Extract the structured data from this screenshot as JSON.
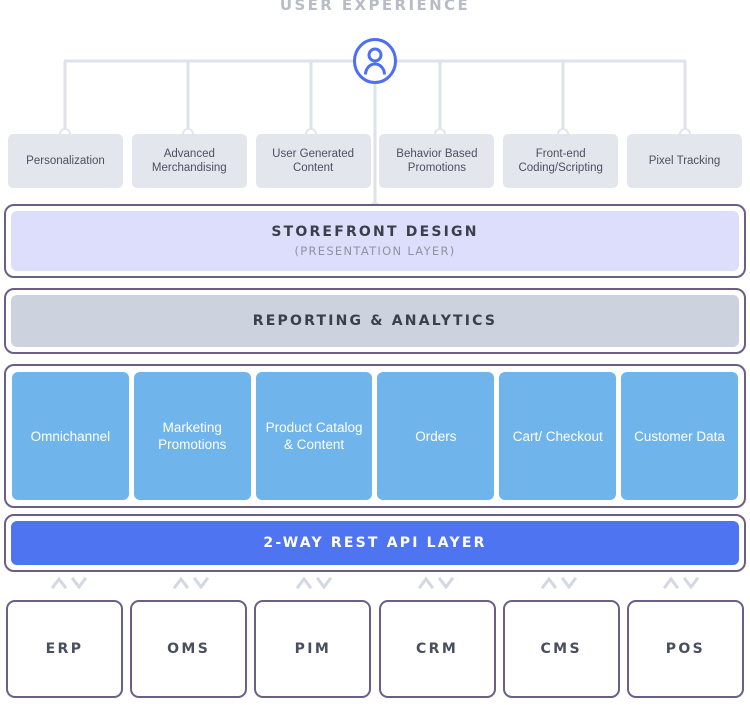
{
  "title": "USER EXPERIENCE",
  "avatar": {
    "icon": "person-in-circle-icon",
    "stroke": "#4f6ef2"
  },
  "ux_features": [
    {
      "label": "Personalization"
    },
    {
      "label": "Advanced Merchandising"
    },
    {
      "label": "User Generated Content"
    },
    {
      "label": "Behavior Based Promotions"
    },
    {
      "label": "Front-end Coding/Scripting"
    },
    {
      "label": "Pixel Tracking"
    }
  ],
  "storefront": {
    "title": "STOREFRONT DESIGN",
    "subtitle": "(PRESENTATION LAYER)",
    "fill": "#dcdefb"
  },
  "reporting": {
    "title": "REPORTING & ANALYTICS",
    "fill": "#ccd2de"
  },
  "services": [
    {
      "label": "Omnichannel"
    },
    {
      "label": "Marketing Promotions"
    },
    {
      "label": "Product Catalog & Content"
    },
    {
      "label": "Orders"
    },
    {
      "label": "Cart/ Checkout"
    },
    {
      "label": "Customer Data"
    }
  ],
  "services_fill": "#70b4ec",
  "api": {
    "title": "2-WAY REST API LAYER",
    "fill": "#4f74f2"
  },
  "arrows": {
    "up_icon": "chevron-up-icon",
    "down_icon": "chevron-down-icon",
    "count": 6,
    "color": "#d4d8e2"
  },
  "systems": [
    {
      "label": "ERP"
    },
    {
      "label": "OMS"
    },
    {
      "label": "PIM"
    },
    {
      "label": "CRM"
    },
    {
      "label": "CMS"
    },
    {
      "label": "POS"
    }
  ],
  "colors": {
    "frame_border": "#6b5f85",
    "ux_box_fill": "#e4e6ee",
    "connector_line": "#dfe2e9",
    "title_gray": "#b7bcc6"
  }
}
